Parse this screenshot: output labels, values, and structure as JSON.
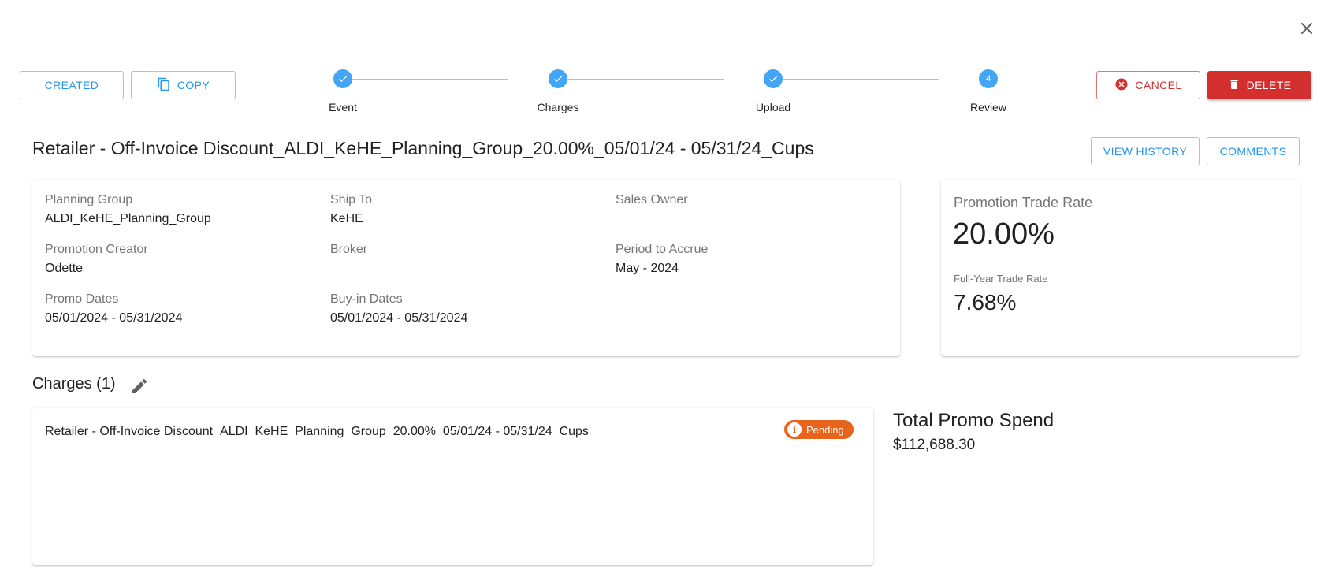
{
  "header": {
    "created_label": "CREATED",
    "copy_label": "COPY",
    "cancel_label": "CANCEL",
    "delete_label": "DELETE",
    "view_history_label": "VIEW HISTORY",
    "comments_label": "COMMENTS"
  },
  "stepper": {
    "steps": [
      {
        "label": "Event",
        "state": "completed"
      },
      {
        "label": "Charges",
        "state": "completed"
      },
      {
        "label": "Upload",
        "state": "completed"
      },
      {
        "label": "Review",
        "state": "active",
        "number": "4"
      }
    ]
  },
  "promotion": {
    "title": "Retailer - Off-Invoice Discount_ALDI_KeHE_Planning_Group_20.00%_05/01/24 - 05/31/24_Cups",
    "details": {
      "planning_group": {
        "label": "Planning Group",
        "value": "ALDI_KeHE_Planning_Group"
      },
      "ship_to": {
        "label": "Ship To",
        "value": "KeHE"
      },
      "sales_owner": {
        "label": "Sales Owner",
        "value": ""
      },
      "promotion_creator": {
        "label": "Promotion Creator",
        "value": "Odette"
      },
      "broker": {
        "label": "Broker",
        "value": ""
      },
      "period_to_accrue": {
        "label": "Period to Accrue",
        "value": "May - 2024"
      },
      "promo_dates": {
        "label": "Promo Dates",
        "value": "05/01/2024 - 05/31/2024"
      },
      "buy_in_dates": {
        "label": "Buy-in Dates",
        "value": "05/01/2024 - 05/31/2024"
      }
    },
    "rates": {
      "promotion_trade_rate_label": "Promotion Trade Rate",
      "promotion_trade_rate": "20.00%",
      "full_year_trade_rate_label": "Full-Year Trade Rate",
      "full_year_trade_rate": "7.68%"
    }
  },
  "charges": {
    "heading": "Charges (1)",
    "items": [
      {
        "name": "Retailer - Off-Invoice Discount_ALDI_KeHE_Planning_Group_20.00%_05/01/24 - 05/31/24_Cups",
        "status": "Pending"
      }
    ]
  },
  "spend": {
    "label": "Total Promo Spend",
    "value": "$112,688.30"
  },
  "colors": {
    "accent_blue": "#2196f3",
    "step_blue": "#42a5f5",
    "danger_red": "#d32f2f",
    "pending_orange": "#e8641c"
  }
}
